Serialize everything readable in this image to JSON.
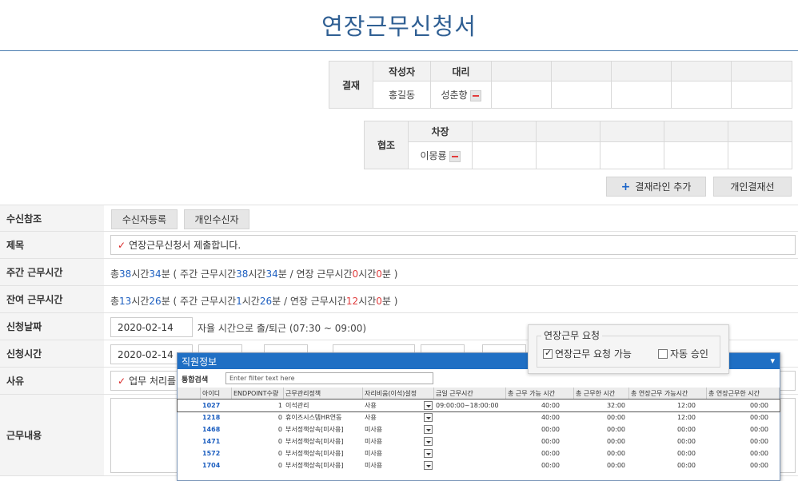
{
  "page_title": "연장근무신청서",
  "approval": {
    "side_label": "결재",
    "headers": [
      "작성자",
      "대리",
      "",
      "",
      "",
      "",
      ""
    ],
    "names": [
      "홍길동",
      "성춘향",
      "",
      "",
      "",
      "",
      ""
    ]
  },
  "cooperation": {
    "side_label": "협조",
    "headers": [
      "차장",
      "",
      "",
      "",
      "",
      ""
    ],
    "names": [
      "이몽룡",
      "",
      "",
      "",
      "",
      ""
    ]
  },
  "buttons": {
    "add_line": "결재라인 추가",
    "personal_line": "개인결재선",
    "receiver_register": "수신자등록",
    "personal_receiver": "개인수신자"
  },
  "form": {
    "receiver_label": "수신참조",
    "subject_label": "제목",
    "subject_value": "연장근무신청서 제출합니다.",
    "weekly_label": "주간 근무시간",
    "weekly": {
      "p1": "총 ",
      "h": "38",
      "p2": "시간 ",
      "m": "34",
      "p3": "분 ( 주간 근무시간 ",
      "h2": "38",
      "p4": "시간 ",
      "m2": "34",
      "p5": "분 / 연장 근무시간 ",
      "h3": "0",
      "p6": "시간 ",
      "m3": "0",
      "p7": "분 )"
    },
    "remain_label": "잔여 근무시간",
    "remain": {
      "p1": "총 ",
      "h": "13",
      "p2": "시간 ",
      "m": "26",
      "p3": "분 ( 주간 근무시간 ",
      "h2": "1",
      "p4": "시간 ",
      "m2": "26",
      "p5": "분 / 연장 근무시간 ",
      "h3": "12",
      "p6": "시간 ",
      "m3": "0",
      "p7": "분 )"
    },
    "date_label": "신청날짜",
    "date_value": "2020-02-14",
    "date_note": "자율 시간으로 출/퇴근 (07:30 ~ 09:00)",
    "time_label": "신청시간",
    "time_value": "2020-02-14",
    "reason_label": "사유",
    "reason_value": "업무 처리를",
    "content_label": "근무내용"
  },
  "overtime_box": {
    "legend": "연장근무 요청",
    "option1": "연장근무 요청 가능",
    "option1_checked": true,
    "option2": "자동 승인",
    "option2_checked": false
  },
  "popup": {
    "title": "직원정보",
    "filter_label": "통합검색",
    "filter_placeholder": "Enter filter text here",
    "columns": [
      "아이디",
      "ENDPOINT수량",
      "근무관리정책",
      "자리비움(이석)설정",
      "금일 근무시간",
      "총 근무 가능 시간",
      "총 근무한 시간",
      "총 연장근무 가능시간",
      "총 연장근무한 시간"
    ],
    "rows": [
      {
        "id": "1027",
        "ep": "1",
        "policy": "이석관리",
        "away": "사용",
        "today": "09:00:00~18:00:00",
        "avail": "40:00",
        "worked": "32:00",
        "ot_avail": "12:00",
        "ot_worked": "00:00"
      },
      {
        "id": "1218",
        "ep": "0",
        "policy": "휴이즈시스템HR연동",
        "away": "사용",
        "today": "",
        "avail": "40:00",
        "worked": "00:00",
        "ot_avail": "12:00",
        "ot_worked": "00:00"
      },
      {
        "id": "1468",
        "ep": "0",
        "policy": "부서정책상속[미사용]",
        "away": "미사용",
        "today": "",
        "avail": "00:00",
        "worked": "00:00",
        "ot_avail": "00:00",
        "ot_worked": "00:00"
      },
      {
        "id": "1471",
        "ep": "0",
        "policy": "부서정책상속[미사용]",
        "away": "미사용",
        "today": "",
        "avail": "00:00",
        "worked": "00:00",
        "ot_avail": "00:00",
        "ot_worked": "00:00"
      },
      {
        "id": "1572",
        "ep": "0",
        "policy": "부서정책상속[미사용]",
        "away": "미사용",
        "today": "",
        "avail": "00:00",
        "worked": "00:00",
        "ot_avail": "00:00",
        "ot_worked": "00:00"
      },
      {
        "id": "1704",
        "ep": "0",
        "policy": "부서정책상속[미사용]",
        "away": "미사용",
        "today": "",
        "avail": "00:00",
        "worked": "00:00",
        "ot_avail": "00:00",
        "ot_worked": "00:00"
      }
    ]
  }
}
